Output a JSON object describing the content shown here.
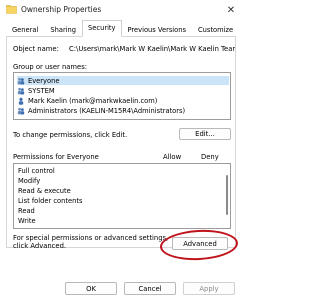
{
  "window": {
    "title": "Ownership Properties",
    "icon": "folder-icon",
    "close_glyph": "✕"
  },
  "tabs": [
    {
      "label": "General",
      "active": false
    },
    {
      "label": "Sharing",
      "active": false
    },
    {
      "label": "Security",
      "active": true
    },
    {
      "label": "Previous Versions",
      "active": false
    },
    {
      "label": "Customize",
      "active": false
    }
  ],
  "security": {
    "object_name_label": "Object name:",
    "object_name_value": "C:\\Users\\mark\\Mark W Kaelin\\Mark W Kaelin Team Si",
    "group_label": "Group or user names:",
    "users": [
      {
        "name": "Everyone",
        "icon": "users-group-icon",
        "selected": true
      },
      {
        "name": "SYSTEM",
        "icon": "users-group-icon",
        "selected": false
      },
      {
        "name": "Mark Kaelin (mark@markwkaelin.com)",
        "icon": "user-icon",
        "selected": false
      },
      {
        "name": "Administrators (KAELIN-M15R4\\Administrators)",
        "icon": "users-group-icon",
        "selected": false
      }
    ],
    "change_permissions_text": "To change permissions, click Edit.",
    "edit_button": "Edit...",
    "permissions_label": "Permissions for Everyone",
    "allow_header": "Allow",
    "deny_header": "Deny",
    "permissions": [
      "Full control",
      "Modify",
      "Read & execute",
      "List folder contents",
      "Read",
      "Write"
    ],
    "special_text_line1": "For special permissions or advanced settings,",
    "special_text_line2": "click Advanced.",
    "advanced_button": "Advanced"
  },
  "footer": {
    "ok": "OK",
    "cancel": "Cancel",
    "apply": "Apply"
  },
  "colors": {
    "selection": "#cce4f7",
    "highlight_oval": "#c0141c"
  }
}
